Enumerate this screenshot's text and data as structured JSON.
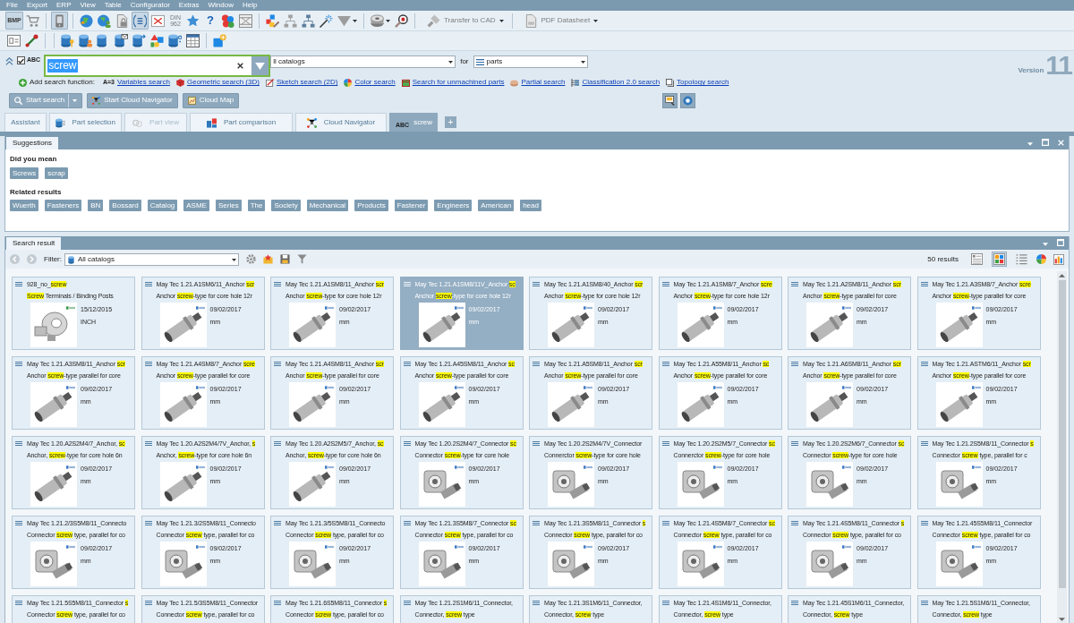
{
  "menu": [
    "File",
    "Export",
    "ERP",
    "View",
    "Table",
    "Configurator",
    "Extras",
    "Window",
    "Help"
  ],
  "toolbar": [
    {
      "label": "BMP",
      "pressed": true
    },
    {
      "pressed": false
    },
    {
      "pressed": true
    },
    {
      "pressed": false
    },
    {
      "pressed": false
    },
    {
      "pressed": false
    },
    {
      "pressed": true
    },
    {
      "pressed": false
    },
    {
      "label": "DIN 962",
      "pressed": false
    },
    {
      "pressed": false
    },
    {
      "label": "?",
      "pressed": false
    },
    {
      "pressed": false
    },
    {
      "pressed": false
    },
    {
      "pressed": false
    },
    {
      "pressed": false
    },
    {
      "pressed": false
    },
    {
      "pressed": false
    },
    {
      "pressed": false
    },
    {
      "pressed": false
    },
    {
      "pressed": false
    }
  ],
  "toolbar_actions": [
    {
      "label": "Transfer to CAD",
      "disabled": true
    },
    {
      "label": "PDF Datasheet",
      "disabled": true
    }
  ],
  "search": {
    "exact": {
      "label": "ABC",
      "checked": true
    },
    "query": "screw",
    "catalog": "ll catalogs",
    "for_label": "for",
    "scope": "parts"
  },
  "version": {
    "label": "Version",
    "number": "11"
  },
  "search_functions": {
    "label": "Add search function:",
    "links": [
      {
        "symbol": "A=3",
        "text": "Variables search"
      },
      {
        "text": "Geometric search (3D)"
      },
      {
        "text": "Sketch search (2D)"
      },
      {
        "text": "Color search"
      },
      {
        "text": "Search for unmachined parts"
      },
      {
        "text": "Partial search"
      },
      {
        "text": "Classification 2.0 search"
      },
      {
        "text": "Topology search"
      }
    ]
  },
  "actions": [
    "Start search",
    "Start Cloud Navigator",
    "Cloud Map"
  ],
  "tabs": [
    {
      "label": "Assistant",
      "selected": false,
      "disabled": false
    },
    {
      "label": "Part selection",
      "selected": false,
      "disabled": false
    },
    {
      "label": "Part view",
      "selected": false,
      "disabled": true
    },
    {
      "label": "Part comparison",
      "selected": false,
      "disabled": false
    },
    {
      "label": "Cloud Navigator",
      "selected": false,
      "disabled": false
    },
    {
      "label": "screw",
      "badge": "ABC",
      "selected": true,
      "disabled": false
    }
  ],
  "new_tab": "+",
  "suggestions": {
    "title": "Suggestions",
    "did_you_mean": {
      "heading": "Did you mean",
      "terms": [
        "Screws",
        "scrap"
      ]
    },
    "related": {
      "heading": "Related results",
      "terms": [
        "Wuerth",
        "Fasteners",
        "BN",
        "Bossard",
        "Catalog",
        "ASME",
        "Series",
        "The",
        "Society",
        "Mechanical",
        "Products",
        "Fastener",
        "Engineers",
        "American",
        "head"
      ]
    }
  },
  "results": {
    "title": "Search result",
    "filter_label": "Filter:",
    "filter": "All catalogs",
    "count": "50 results",
    "views": [
      {
        "selected": false
      },
      {
        "selected": true
      },
      {
        "selected": false
      }
    ],
    "cards": [
      {
        "title": {
          "pre": "928_no_",
          "hit": "screw"
        },
        "description": {
          "hit": "Screw",
          "post": " Terminals / Binding Posts"
        },
        "date": "15/12/2015",
        "unit": "INCH",
        "kind": "terminal",
        "selected": false
      },
      {
        "title": {
          "pre": "May Tec 1.21.A1SM6/11_Anchor ",
          "hit": "scr"
        },
        "description": {
          "pre": "Anchor ",
          "hit": "screw",
          "post": "-type for core hole 12r"
        },
        "date": "09/02/2017",
        "unit": "mm",
        "kind": "anchor",
        "selected": false
      },
      {
        "title": {
          "pre": "May Tec 1.21.A1SM8/11_Anchor ",
          "hit": "scr"
        },
        "description": {
          "pre": "Anchor ",
          "hit": "screw",
          "post": "-type for core hole 12r"
        },
        "date": "09/02/2017",
        "unit": "mm",
        "kind": "anchor",
        "selected": false
      },
      {
        "title": {
          "pre": "May Tec 1.21.A1SM8/11V_Anchor ",
          "hit": "sc"
        },
        "description": {
          "pre": "Anchor ",
          "hit": "screw",
          "post": "-type for core hole 12r"
        },
        "date": "09/02/2017",
        "unit": "mm",
        "kind": "anchor",
        "selected": true
      },
      {
        "title": {
          "pre": "May Tec 1.21.A1SM8/40_Anchor ",
          "hit": "scr"
        },
        "description": {
          "pre": "Anchor ",
          "hit": "screw",
          "post": "-type for core hole 12r"
        },
        "date": "09/02/2017",
        "unit": "mm",
        "kind": "anchor",
        "selected": false
      },
      {
        "title": {
          "pre": "May Tec 1.21.A1SM8/7_Anchor ",
          "hit": "scre"
        },
        "description": {
          "pre": "Anchor ",
          "hit": "screw",
          "post": "-type for core hole 12r"
        },
        "date": "09/02/2017",
        "unit": "mm",
        "kind": "anchor",
        "selected": false
      },
      {
        "title": {
          "pre": "May Tec 1.21.A2SM8/11_Anchor ",
          "hit": "scr"
        },
        "description": {
          "pre": "Anchor ",
          "hit": "screw",
          "post": "-type parallel for core"
        },
        "date": "09/02/2017",
        "unit": "mm",
        "kind": "anchor",
        "selected": false
      },
      {
        "title": {
          "pre": "May Tec 1.21.A3SM8/7_Anchor ",
          "hit": "scre"
        },
        "description": {
          "pre": "Anchor ",
          "hit": "screw",
          "post": "-type parallel for core"
        },
        "date": "09/02/2017",
        "unit": "mm",
        "kind": "anchor",
        "selected": false
      },
      {
        "title": {
          "pre": "May Tec 1.21.A3SM8/11_Anchor ",
          "hit": "scr"
        },
        "description": {
          "pre": "Anchor ",
          "hit": "screw",
          "post": "-type parallel for core"
        },
        "date": "09/02/2017",
        "unit": "mm",
        "kind": "anchor",
        "selected": false
      },
      {
        "title": {
          "pre": "May Tec 1.21.A4SM8/7_Anchor ",
          "hit": "scre"
        },
        "description": {
          "pre": "Anchor ",
          "hit": "screw",
          "post": "-type parallel for core"
        },
        "date": "09/02/2017",
        "unit": "mm",
        "kind": "anchor",
        "selected": false
      },
      {
        "title": {
          "pre": "May Tec 1.21.A4SM8/11_Anchor ",
          "hit": "scr"
        },
        "description": {
          "pre": "Anchor ",
          "hit": "screw",
          "post": "-type parallel for core"
        },
        "date": "09/02/2017",
        "unit": "mm",
        "kind": "anchor",
        "selected": false
      },
      {
        "title": {
          "pre": "May Tec 1.21.A45SM8/11_Anchor ",
          "hit": "sc"
        },
        "description": {
          "pre": "Anchor ",
          "hit": "screw",
          "post": "-type parallel for core"
        },
        "date": "09/02/2017",
        "unit": "mm",
        "kind": "anchor",
        "selected": false
      },
      {
        "title": {
          "pre": "May Tec 1.21.A5SM8/11_Anchor ",
          "hit": "scr"
        },
        "description": {
          "pre": "Anchor ",
          "hit": "screw",
          "post": "-type parallel for core"
        },
        "date": "09/02/2017",
        "unit": "mm",
        "kind": "anchor",
        "selected": false
      },
      {
        "title": {
          "pre": "May Tec 1.21.A55M8/11_Anchor ",
          "hit": "sc"
        },
        "description": {
          "pre": "Anchor ",
          "hit": "screw",
          "post": "-type parallel for core"
        },
        "date": "09/02/2017",
        "unit": "mm",
        "kind": "anchor",
        "selected": false
      },
      {
        "title": {
          "pre": "May Tec 1.21.A6SM8/11_Anchor ",
          "hit": "scr"
        },
        "description": {
          "pre": "Anchor ",
          "hit": "screw",
          "post": "-type parallel for core"
        },
        "date": "09/02/2017",
        "unit": "mm",
        "kind": "anchor",
        "selected": false
      },
      {
        "title": {
          "pre": "May Tec 1.21.ASTM6/11_Anchor ",
          "hit": "scr"
        },
        "description": {
          "pre": "Anchor ",
          "hit": "screw",
          "post": "-type parallel for core"
        },
        "date": "09/02/2017",
        "unit": "mm",
        "kind": "anchor",
        "selected": false
      },
      {
        "title": {
          "pre": "May Tec 1.20.A2S2M4/7_Anchor, ",
          "hit": "sc"
        },
        "description": {
          "pre": "Anchor, ",
          "hit": "screw",
          "post": "-type for core hole 6n"
        },
        "date": "09/02/2017",
        "unit": "mm",
        "kind": "anchor",
        "selected": false
      },
      {
        "title": {
          "pre": "May Tec 1.20.A2S2M4/7V_Anchor, ",
          "hit": "s"
        },
        "description": {
          "pre": "Anchor, ",
          "hit": "screw",
          "post": "-type for core hole 6n"
        },
        "date": "09/02/2017",
        "unit": "mm",
        "kind": "anchor",
        "selected": false
      },
      {
        "title": {
          "pre": "May Tec 1.20.A2S2M5/7_Anchor, ",
          "hit": "sc"
        },
        "description": {
          "pre": "Anchor, ",
          "hit": "screw",
          "post": "-type for core hole 6n"
        },
        "date": "09/02/2017",
        "unit": "mm",
        "kind": "anchor",
        "selected": false
      },
      {
        "title": {
          "pre": "May Tec 1.20.2S2M4/7_Connector ",
          "hit": "sc"
        },
        "description": {
          "pre": "Connector ",
          "hit": "screw",
          "post": "-type for core hole"
        },
        "date": "09/02/2017",
        "unit": "mm",
        "kind": "connector",
        "selected": false
      },
      {
        "title": {
          "pre": "May Tec 1.20.2S2M4/7V_Connector"
        },
        "description": {
          "pre": "Connerctor ",
          "hit": "screw",
          "post": "-type for core hole"
        },
        "date": "09/02/2017",
        "unit": "mm",
        "kind": "connector",
        "selected": false
      },
      {
        "title": {
          "pre": "May Tec 1.20.2S2M5/7_Connector ",
          "hit": "sc"
        },
        "description": {
          "pre": "Connerctor ",
          "hit": "screw",
          "post": "-type for core hole"
        },
        "date": "09/02/2017",
        "unit": "mm",
        "kind": "connector",
        "selected": false
      },
      {
        "title": {
          "pre": "May Tec 1.20.2S2M6/7_Connector ",
          "hit": "sc"
        },
        "description": {
          "pre": "Connector ",
          "hit": "screw",
          "post": "-type for core hole"
        },
        "date": "09/02/2017",
        "unit": "mm",
        "kind": "connector",
        "selected": false
      },
      {
        "title": {
          "pre": "May Tec 1.21.2S5M8/11_Connector ",
          "hit": "s"
        },
        "description": {
          "pre": "Connector ",
          "hit": "screw",
          "post": " type, parallel for c"
        },
        "date": "09/02/2017",
        "unit": "mm",
        "kind": "connector",
        "selected": false
      },
      {
        "title": {
          "pre": "May Tec 1.21.2/3S5M8/11_Connecto"
        },
        "description": {
          "pre": "Connector ",
          "hit": "screw",
          "post": " type, parallel for co"
        },
        "date": "09/02/2017",
        "unit": "mm",
        "kind": "connector",
        "selected": false
      },
      {
        "title": {
          "pre": "May Tec 1.21.3/2S5M8/11_Connecto"
        },
        "description": {
          "pre": "Connector ",
          "hit": "screw",
          "post": " type, parallel for co"
        },
        "date": "09/02/2017",
        "unit": "mm",
        "kind": "connector",
        "selected": false
      },
      {
        "title": {
          "pre": "May Tec 1.21.3/5S5M8/11_Connecto"
        },
        "description": {
          "pre": "Connector ",
          "hit": "screw",
          "post": " type, parallel for co"
        },
        "date": "09/02/2017",
        "unit": "mm",
        "kind": "connector",
        "selected": false
      },
      {
        "title": {
          "pre": "May Tec 1.21.3S5M8/7_Connector ",
          "hit": "sc"
        },
        "description": {
          "pre": "Connector ",
          "hit": "screw",
          "post": " type, parallel for co"
        },
        "date": "09/02/2017",
        "unit": "mm",
        "kind": "connector",
        "selected": false
      },
      {
        "title": {
          "pre": "May Tec 1.21.3S5M8/11_Connector ",
          "hit": "s"
        },
        "description": {
          "pre": "Connector ",
          "hit": "screw",
          "post": " type, parallel for co"
        },
        "date": "09/02/2017",
        "unit": "mm",
        "kind": "connector",
        "selected": false
      },
      {
        "title": {
          "pre": "May Tec 1.21.4S5M8/7_Connector ",
          "hit": "sc"
        },
        "description": {
          "pre": "Connector ",
          "hit": "screw",
          "post": " type, parallel for co"
        },
        "date": "09/02/2017",
        "unit": "mm",
        "kind": "connector",
        "selected": false
      },
      {
        "title": {
          "pre": "May Tec 1.21.4S5M8/11_Connector ",
          "hit": "s"
        },
        "description": {
          "pre": "Connector ",
          "hit": "screw",
          "post": " type, parallel for co"
        },
        "date": "09/02/2017",
        "unit": "mm",
        "kind": "connector",
        "selected": false
      },
      {
        "title": {
          "pre": "May Tec 1.21.45S5M8/11_Connector"
        },
        "description": {
          "pre": "Connector ",
          "hit": "screw",
          "post": " type, parallel for co"
        },
        "date": "09/02/2017",
        "unit": "mm",
        "kind": "connector",
        "selected": false
      },
      {
        "title": {
          "pre": "May Tec 1.21.5S5M8/11_Connector ",
          "hit": "s"
        },
        "description": {
          "pre": "Connector ",
          "hit": "screw",
          "post": " type, parallel for co"
        },
        "selected": false
      },
      {
        "title": {
          "pre": "May Tec 1.21.5/3S5M8/11_Connector"
        },
        "description": {
          "pre": "Connector ",
          "hit": "screw",
          "post": " type, parallel for co"
        },
        "selected": false
      },
      {
        "title": {
          "pre": "May Tec 1.21.6S5M8/11_Connector ",
          "hit": "s"
        },
        "description": {
          "pre": "Connector ",
          "hit": "screw",
          "post": " type, parallel for co"
        },
        "selected": false
      },
      {
        "title": {
          "pre": "May Tec 1.21.2S1M6/11_Connector,"
        },
        "description": {
          "pre": "Connector, ",
          "hit": "screw",
          "post": " type"
        },
        "selected": false
      },
      {
        "title": {
          "pre": "May Tec 1.21.3S1M6/11_Connector,"
        },
        "description": {
          "pre": "Connector, ",
          "hit": "screw",
          "post": " type"
        },
        "selected": false
      },
      {
        "title": {
          "pre": "May Tec 1.21.4S1M6/11_Connector,"
        },
        "description": {
          "pre": "Connector, ",
          "hit": "screw",
          "post": " type"
        },
        "selected": false
      },
      {
        "title": {
          "pre": "May Tec 1.21.45S1M6/11_Connector,"
        },
        "description": {
          "pre": "Connector, ",
          "hit": "screw",
          "post": " type"
        },
        "selected": false
      },
      {
        "title": {
          "pre": "May Tec 1.21.5S1M6/11_Connector,"
        },
        "description": {
          "pre": "Connector, ",
          "hit": "screw",
          "post": " type"
        },
        "selected": false
      }
    ]
  }
}
